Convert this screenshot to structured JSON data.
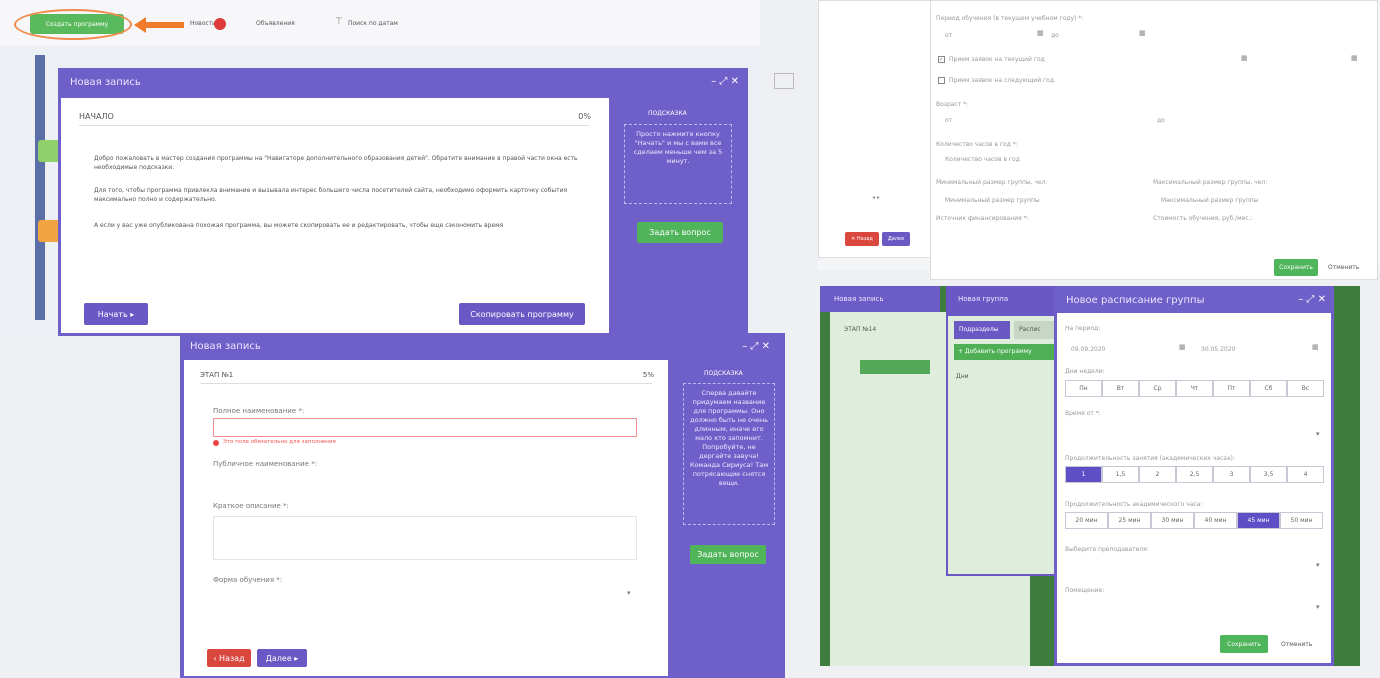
{
  "topbar": {
    "active_button": "Создать программу",
    "news": "Новости",
    "news_badge": "",
    "ads": "Объявления",
    "search": "Поиск по датам"
  },
  "modal1": {
    "title": "Новая запись",
    "step": "НАЧАЛО",
    "progress": "0%",
    "p1": "Добро пожаловать в мастер создания программы на \"Навигаторе дополнительного образования детей\". Обратите внимание в правой части окна есть необходимые подсказки.",
    "p2": "Для того, чтобы программа привлекла внимание и вызывала интерес большего числа посетителей сайта, необходимо оформить карточку события максимально полно и содержательно.",
    "p3": "А если у вас уже опубликована похожая программа, вы можете скопировать ее и редактировать, чтобы еще сэкономить время",
    "start": "Начать ▸",
    "copy": "Скопировать программу",
    "hint_title": "ПОДСКАЗКА",
    "hint_text": "Просто нажмите кнопку \"Начать\" и мы с вами все сделаем меньше чем за 5 минут.",
    "ask": "Задать вопрос"
  },
  "modal2": {
    "title": "Новая запись",
    "step": "ЭТАП №1",
    "progress": "5%",
    "full_name": "Полное наименование *:",
    "error": "Это поле обязательно для заполнения",
    "public_name": "Публичное наименование *:",
    "short_desc": "Краткое описание *:",
    "form": "Форма обучения *:",
    "back": "‹ Назад",
    "next": "Далее ▸",
    "hint_title": "ПОДСКАЗКА",
    "hint_text": "Сперва давайте придумаем название для программы. Оно должно быть не очень длинным, иначе его мало кто запомнит. Попробуйте, не дергайте завуча! Команда Сириусa! Там потрясающие снятся вещи.",
    "ask": "Задать вопрос"
  },
  "topright": {
    "period": "Период обучения (в текущем учебном году) *:",
    "from": "от",
    "to": "до",
    "cb1": "Прием заявок на текущий год",
    "cb2": "Прием заявок на следующий год",
    "age": "Возраст *:",
    "age_from": "от",
    "age_to": "до",
    "hours": "Количество часов в год *:",
    "hours_ph": "Количество часов в год",
    "min": "Минимальный размер группы, чел:",
    "min_ph": "Минимальный размер группы",
    "max": "Максимальный размер группы, чел:",
    "max_ph": "Максимальный размер группы",
    "funding": "Источник финансирования *:",
    "cost": "Стоимость обучения, руб./мес.:",
    "save": "Сохранить",
    "cancel": "Отменить",
    "delete": "✕ Назад",
    "next": "Далее"
  },
  "bottomright": {
    "back_title": "Новая запись",
    "mid_title": "Новая группа",
    "step": "ЭТАП №14",
    "tab1": "Подразделы",
    "tab2": "Распис",
    "add": "+ Добавить программу",
    "days": "Дни",
    "title": "Новое расписание группы",
    "period": "На период:",
    "d1": "09.09.2020",
    "d2": "30.05.2020",
    "weekdays_label": "Дни недели:",
    "weekdays": [
      "Пн",
      "Вт",
      "Ср",
      "Чт",
      "Пт",
      "Сб",
      "Вс"
    ],
    "time_label": "Время от *:",
    "dur_label": "Продолжительность занятия (академических часах):",
    "durations": [
      "1",
      "1,5",
      "2",
      "2,5",
      "3",
      "3,5",
      "4"
    ],
    "acad_label": "Продолжительность академического часа:",
    "acad": [
      "20 мин",
      "25 мин",
      "30 мин",
      "40 мин",
      "45 мин",
      "50 мин"
    ],
    "teacher": "Выберите преподавателя:",
    "room": "Помещение:",
    "save": "Сохранить",
    "cancel": "Отменить"
  }
}
